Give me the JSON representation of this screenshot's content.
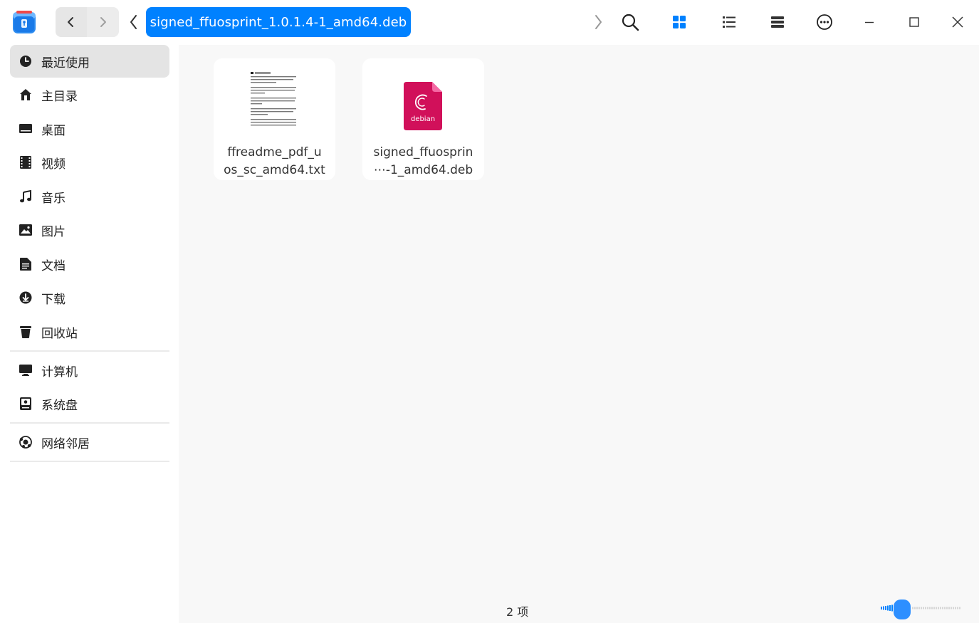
{
  "titlebar": {
    "breadcrumb": "signed_ffuosprint_1.0.1.4-1_amd64.deb",
    "icons": {
      "app": "file-manager-icon",
      "back": "chevron-left-icon",
      "forward": "chevron-right-icon",
      "crumb_prev": "chevron-left-icon",
      "crumb_next": "chevron-right-icon",
      "search": "search-icon",
      "icon_view": "grid-view-icon",
      "list_view": "list-view-icon",
      "tree_view": "tree-view-icon",
      "menu": "more-icon",
      "minimize": "minimize-icon",
      "maximize": "maximize-icon",
      "close": "close-icon"
    },
    "accent_color": "#0081ff"
  },
  "sidebar": {
    "items": [
      {
        "label": "最近使用",
        "icon": "clock-icon"
      },
      {
        "label": "主目录",
        "icon": "home-icon"
      },
      {
        "label": "桌面",
        "icon": "desktop-icon"
      },
      {
        "label": "视频",
        "icon": "video-icon"
      },
      {
        "label": "音乐",
        "icon": "music-icon"
      },
      {
        "label": "图片",
        "icon": "picture-icon"
      },
      {
        "label": "文档",
        "icon": "document-icon"
      },
      {
        "label": "下载",
        "icon": "download-icon"
      },
      {
        "label": "回收站",
        "icon": "trash-icon"
      },
      {
        "label": "计算机",
        "icon": "computer-icon"
      },
      {
        "label": "系统盘",
        "icon": "disk-icon"
      },
      {
        "label": "网络邻居",
        "icon": "network-icon"
      }
    ]
  },
  "files": [
    {
      "name_line1": "ffreadme_pdf_u",
      "name_line2": "os_sc_amd64.txt",
      "icon": "text-file-thumbnail"
    },
    {
      "name_line1": "signed_ffuosprin",
      "name_line2": "⋯-1_amd64.deb",
      "icon": "debian-package-icon",
      "icon_label": "debian"
    }
  ],
  "status": {
    "item_count": "2 项"
  },
  "zoom": {
    "level": 0.25
  }
}
